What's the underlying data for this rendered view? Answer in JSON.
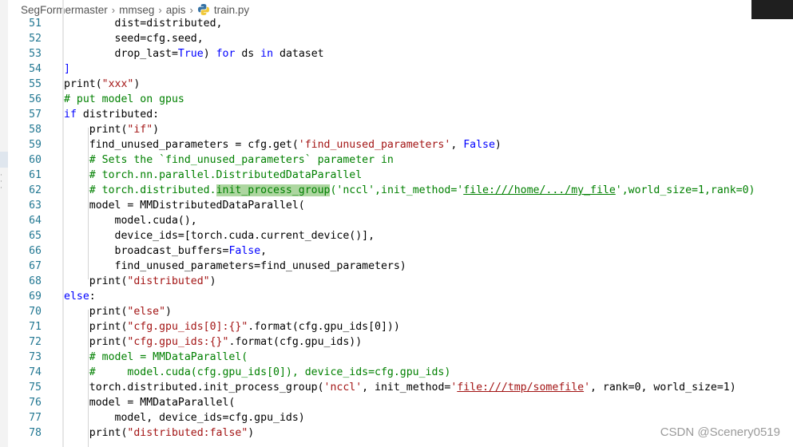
{
  "breadcrumb": {
    "items": [
      "SegFormermaster",
      "mmseg",
      "apis"
    ],
    "file": "train.py"
  },
  "lines": [
    {
      "n": "51",
      "tokens": [
        [
          "fn",
          "        dist=distributed,"
        ]
      ]
    },
    {
      "n": "52",
      "tokens": [
        [
          "fn",
          "        seed=cfg.seed,"
        ]
      ]
    },
    {
      "n": "53",
      "tokens": [
        [
          "fn",
          "        drop_last="
        ],
        [
          "kw",
          "True"
        ],
        [
          "fn",
          ") "
        ],
        [
          "ctl",
          "for"
        ],
        [
          "fn",
          " ds "
        ],
        [
          "ctl",
          "in"
        ],
        [
          "fn",
          " dataset"
        ]
      ]
    },
    {
      "n": "54",
      "tokens": [
        [
          "bracket",
          "]"
        ]
      ]
    },
    {
      "n": "55",
      "tokens": [
        [
          "fn",
          "print("
        ],
        [
          "str",
          "\"xxx\""
        ],
        [
          "fn",
          ")"
        ]
      ]
    },
    {
      "n": "56",
      "tokens": [
        [
          "cmt",
          "# put model on gpus"
        ]
      ]
    },
    {
      "n": "57",
      "tokens": [
        [
          "ctl",
          "if"
        ],
        [
          "fn",
          " distributed:"
        ]
      ]
    },
    {
      "n": "58",
      "tokens": [
        [
          "fn",
          "    print("
        ],
        [
          "str",
          "\"if\""
        ],
        [
          "fn",
          ")"
        ]
      ]
    },
    {
      "n": "59",
      "tokens": [
        [
          "fn",
          "    find_unused_parameters = cfg.get("
        ],
        [
          "str",
          "'find_unused_parameters'"
        ],
        [
          "fn",
          ", "
        ],
        [
          "kw",
          "False"
        ],
        [
          "fn",
          ")"
        ]
      ]
    },
    {
      "n": "60",
      "tokens": [
        [
          "cmt",
          "    # Sets the `find_unused_parameters` parameter in"
        ]
      ]
    },
    {
      "n": "61",
      "tokens": [
        [
          "cmt",
          "    # torch.nn.parallel.DistributedDataParallel"
        ]
      ]
    },
    {
      "n": "62",
      "tokens": [
        [
          "cmt",
          "    # torch.distributed."
        ],
        [
          "cmt hl-sel",
          "init_process_group"
        ],
        [
          "cmt",
          "('nccl',init_method='"
        ],
        [
          "cmt und",
          "file:///home/.../my_file"
        ],
        [
          "cmt",
          "',world_size=1,rank=0)"
        ]
      ]
    },
    {
      "n": "63",
      "tokens": [
        [
          "fn",
          "    model = MMDistributedDataParallel("
        ]
      ]
    },
    {
      "n": "64",
      "tokens": [
        [
          "fn",
          "        model.cuda(),"
        ]
      ]
    },
    {
      "n": "65",
      "tokens": [
        [
          "fn",
          "        device_ids=[torch.cuda.current_device()],"
        ]
      ]
    },
    {
      "n": "66",
      "tokens": [
        [
          "fn",
          "        broadcast_buffers="
        ],
        [
          "kw",
          "False"
        ],
        [
          "fn",
          ","
        ]
      ]
    },
    {
      "n": "67",
      "tokens": [
        [
          "fn",
          "        find_unused_parameters=find_unused_parameters)"
        ]
      ]
    },
    {
      "n": "68",
      "tokens": [
        [
          "fn",
          "    print("
        ],
        [
          "str",
          "\"distributed\""
        ],
        [
          "fn",
          ")"
        ]
      ]
    },
    {
      "n": "69",
      "tokens": [
        [
          "ctl",
          "else"
        ],
        [
          "fn",
          ":"
        ]
      ]
    },
    {
      "n": "70",
      "tokens": [
        [
          "fn",
          "    print("
        ],
        [
          "str",
          "\"else\""
        ],
        [
          "fn",
          ")"
        ]
      ]
    },
    {
      "n": "71",
      "tokens": [
        [
          "fn",
          "    print("
        ],
        [
          "str",
          "\"cfg.gpu_ids[0]:{}\""
        ],
        [
          "fn",
          ".format(cfg.gpu_ids[0]))"
        ]
      ]
    },
    {
      "n": "72",
      "tokens": [
        [
          "fn",
          "    print("
        ],
        [
          "str",
          "\"cfg.gpu_ids:{}\""
        ],
        [
          "fn",
          ".format(cfg.gpu_ids))"
        ]
      ]
    },
    {
      "n": "73",
      "tokens": [
        [
          "cmt",
          "    # model = MMDataParallel("
        ]
      ]
    },
    {
      "n": "74",
      "tokens": [
        [
          "cmt",
          "    #     model.cuda(cfg.gpu_ids[0]), device_ids=cfg.gpu_ids)"
        ]
      ]
    },
    {
      "n": "75",
      "tokens": [
        [
          "fn",
          "    torch.distributed.init_process_group("
        ],
        [
          "str",
          "'nccl'"
        ],
        [
          "fn",
          ", init_method="
        ],
        [
          "str",
          "'"
        ],
        [
          "str und",
          "file:///tmp/somefile"
        ],
        [
          "str",
          "'"
        ],
        [
          "fn",
          ", rank=0, world_size=1)"
        ]
      ]
    },
    {
      "n": "76",
      "tokens": [
        [
          "fn",
          "    model = MMDataParallel("
        ]
      ]
    },
    {
      "n": "77",
      "tokens": [
        [
          "fn",
          "        model, device_ids=cfg.gpu_ids)"
        ]
      ]
    },
    {
      "n": "78",
      "tokens": [
        [
          "fn",
          "    print("
        ],
        [
          "str",
          "\"distributed:false\""
        ],
        [
          "fn",
          ")"
        ]
      ]
    }
  ],
  "watermark": "CSDN @Scenery0519"
}
